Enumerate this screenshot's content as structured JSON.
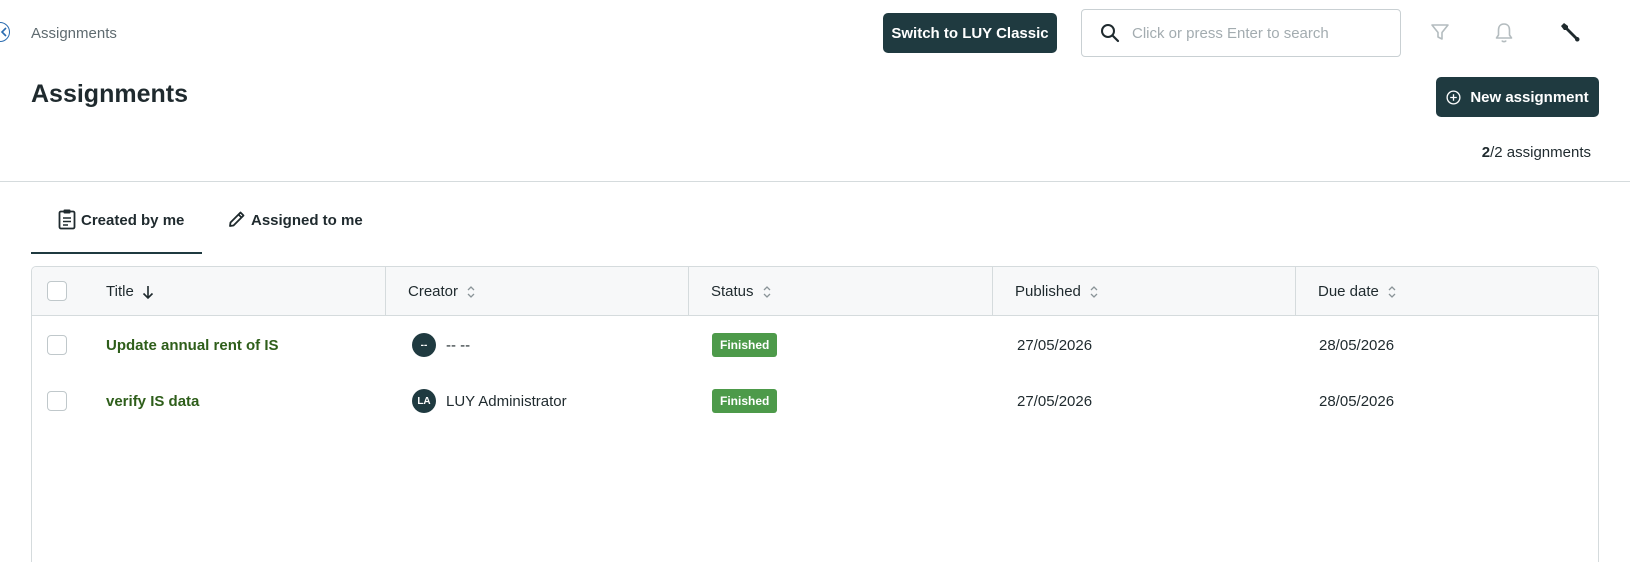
{
  "breadcrumb": "Assignments",
  "top_bar": {
    "switch_button_label": "Switch to LUY Classic",
    "search_placeholder": "Click or press Enter to search",
    "search_value": ""
  },
  "page": {
    "title": "Assignments",
    "new_button_label": "New assignment",
    "count": {
      "shown": "2",
      "rest": "/2 assignments"
    }
  },
  "tabs": [
    {
      "label": "Created by me",
      "icon": "clipboard-icon",
      "active": true
    },
    {
      "label": "Assigned to me",
      "icon": "pencil-icon",
      "active": false
    }
  ],
  "table": {
    "columns": [
      {
        "label": "Title",
        "sort": "descending"
      },
      {
        "label": "Creator",
        "sort": "none"
      },
      {
        "label": "Status",
        "sort": "none"
      },
      {
        "label": "Published",
        "sort": "none"
      },
      {
        "label": "Due date",
        "sort": "none"
      }
    ],
    "rows": [
      {
        "title": "Update annual rent of IS",
        "creator_initials": "--",
        "creator_name": "-- --",
        "status": "Finished",
        "published": "27/05/2026",
        "due_date": "28/05/2026"
      },
      {
        "title": "verify IS data",
        "creator_initials": "LA",
        "creator_name": "LUY Administrator",
        "status": "Finished",
        "published": "27/05/2026",
        "due_date": "28/05/2026"
      }
    ]
  },
  "colors": {
    "primary": "#1f3a40",
    "link": "#2e5e1a",
    "status_finished": "#4d9a4a"
  }
}
